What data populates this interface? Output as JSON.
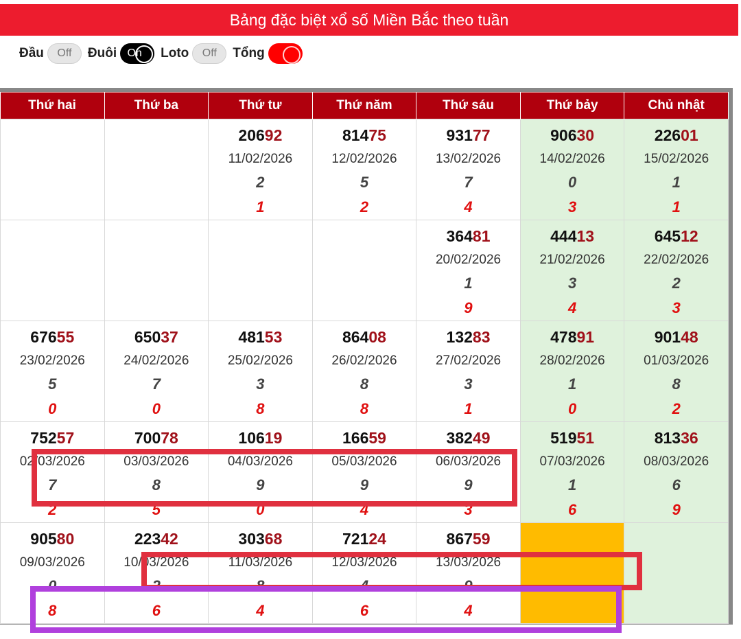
{
  "title": "Bảng đặc biệt xổ số Miền Bắc theo tuần",
  "toggles": [
    {
      "label": "Đầu",
      "state": "Off"
    },
    {
      "label": "Đuôi",
      "state": "On"
    },
    {
      "label": "Loto",
      "state": "Off"
    },
    {
      "label": "Tổng",
      "state": ""
    }
  ],
  "headers": [
    "Thứ hai",
    "Thứ ba",
    "Thứ tư",
    "Thứ năm",
    "Thứ sáu",
    "Thứ bảy",
    "Chủ nhật"
  ],
  "rows": [
    [
      null,
      null,
      {
        "head": "206",
        "tail": "92",
        "date": "11/02/2026",
        "dau": "2",
        "tong": "1"
      },
      {
        "head": "814",
        "tail": "75",
        "date": "12/02/2026",
        "dau": "5",
        "tong": "2"
      },
      {
        "head": "931",
        "tail": "77",
        "date": "13/02/2026",
        "dau": "7",
        "tong": "4"
      },
      {
        "head": "906",
        "tail": "30",
        "date": "14/02/2026",
        "dau": "0",
        "tong": "3"
      },
      {
        "head": "226",
        "tail": "01",
        "date": "15/02/2026",
        "dau": "1",
        "tong": "1"
      }
    ],
    [
      null,
      null,
      null,
      null,
      {
        "head": "364",
        "tail": "81",
        "date": "20/02/2026",
        "dau": "1",
        "tong": "9"
      },
      {
        "head": "444",
        "tail": "13",
        "date": "21/02/2026",
        "dau": "3",
        "tong": "4"
      },
      {
        "head": "645",
        "tail": "12",
        "date": "22/02/2026",
        "dau": "2",
        "tong": "3"
      }
    ],
    [
      {
        "head": "676",
        "tail": "55",
        "date": "23/02/2026",
        "dau": "5",
        "tong": "0"
      },
      {
        "head": "650",
        "tail": "37",
        "date": "24/02/2026",
        "dau": "7",
        "tong": "0"
      },
      {
        "head": "481",
        "tail": "53",
        "date": "25/02/2026",
        "dau": "3",
        "tong": "8"
      },
      {
        "head": "864",
        "tail": "08",
        "date": "26/02/2026",
        "dau": "8",
        "tong": "8"
      },
      {
        "head": "132",
        "tail": "83",
        "date": "27/02/2026",
        "dau": "3",
        "tong": "1"
      },
      {
        "head": "478",
        "tail": "91",
        "date": "28/02/2026",
        "dau": "1",
        "tong": "0"
      },
      {
        "head": "901",
        "tail": "48",
        "date": "01/03/2026",
        "dau": "8",
        "tong": "2"
      }
    ],
    [
      {
        "head": "752",
        "tail": "57",
        "date": "02/03/2026",
        "dau": "7",
        "tong": "2"
      },
      {
        "head": "700",
        "tail": "78",
        "date": "03/03/2026",
        "dau": "8",
        "tong": "5"
      },
      {
        "head": "106",
        "tail": "19",
        "date": "04/03/2026",
        "dau": "9",
        "tong": "0"
      },
      {
        "head": "166",
        "tail": "59",
        "date": "05/03/2026",
        "dau": "9",
        "tong": "4"
      },
      {
        "head": "382",
        "tail": "49",
        "date": "06/03/2026",
        "dau": "9",
        "tong": "3"
      },
      {
        "head": "519",
        "tail": "51",
        "date": "07/03/2026",
        "dau": "1",
        "tong": "6"
      },
      {
        "head": "813",
        "tail": "36",
        "date": "08/03/2026",
        "dau": "6",
        "tong": "9"
      }
    ],
    [
      {
        "head": "905",
        "tail": "80",
        "date": "09/03/2026",
        "dau": "0",
        "tong": "8"
      },
      {
        "head": "223",
        "tail": "42",
        "date": "10/03/2026",
        "dau": "2",
        "tong": "6"
      },
      {
        "head": "303",
        "tail": "68",
        "date": "11/03/2026",
        "dau": "8",
        "tong": "4"
      },
      {
        "head": "721",
        "tail": "24",
        "date": "12/03/2026",
        "dau": "4",
        "tong": "6"
      },
      {
        "head": "867",
        "tail": "59",
        "date": "13/03/2026",
        "dau": "9",
        "tong": "4"
      },
      "pending",
      null
    ]
  ],
  "colors": {
    "title_bg": "#ed1c2e",
    "header_bg": "#b0000d",
    "weekend_bg": "#dff2dc",
    "pending_bg": "#ffbb00",
    "highlight_red": "#e0303f",
    "highlight_purple": "#b040dd"
  }
}
